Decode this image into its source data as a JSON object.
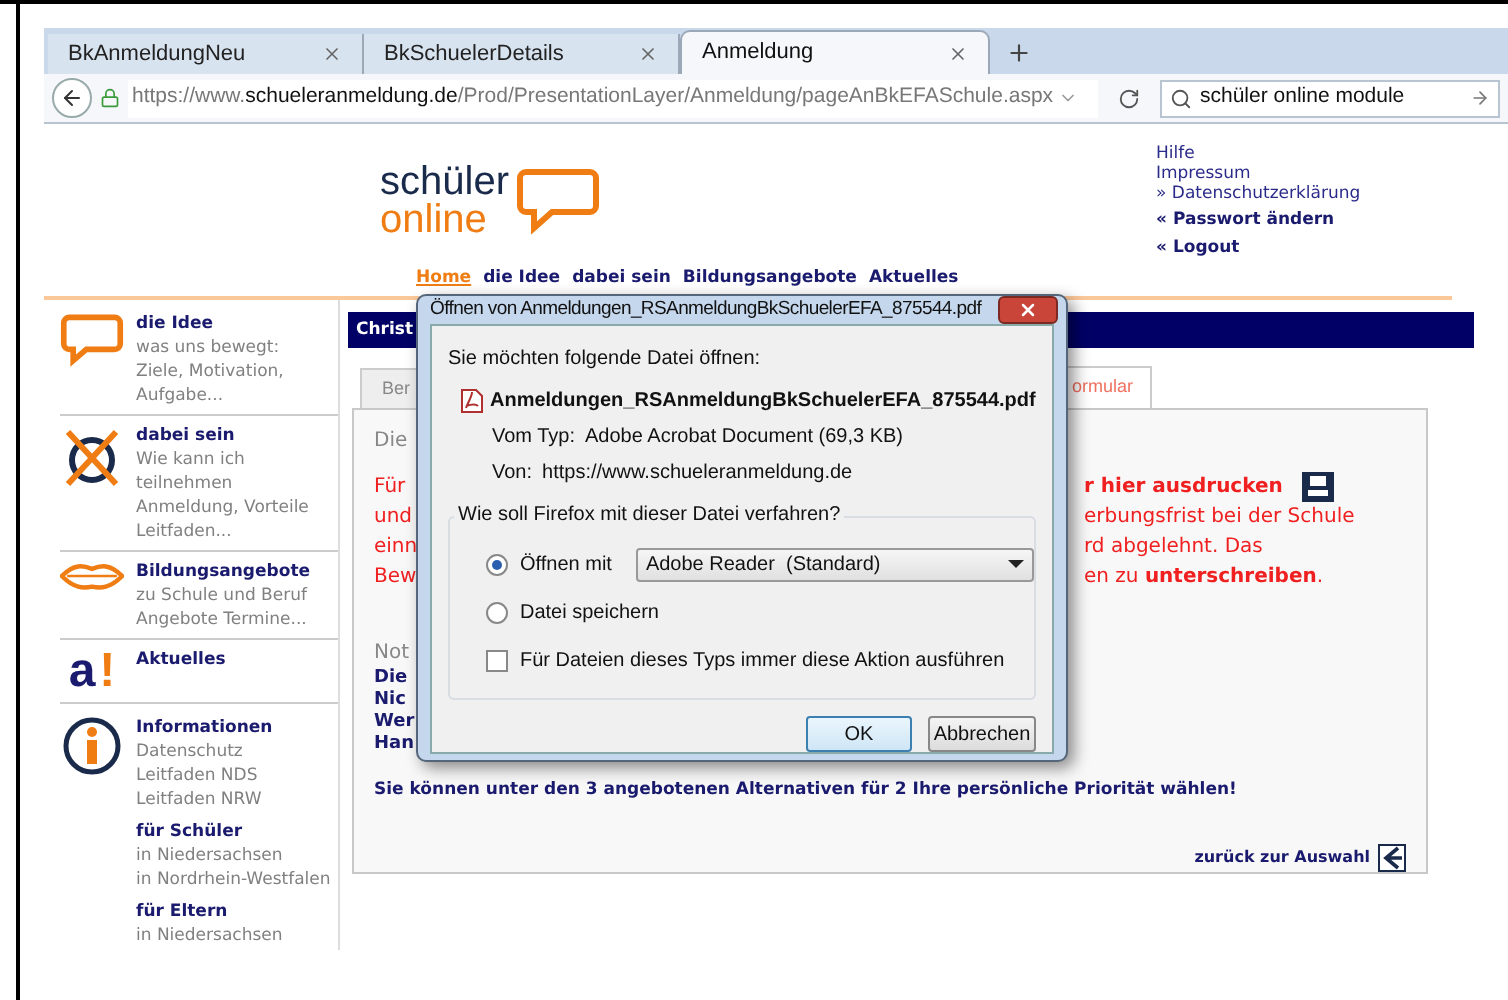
{
  "browser": {
    "tabs": [
      {
        "label": "BkAnmeldungNeu",
        "selected": false
      },
      {
        "label": "BkSchuelerDetails",
        "selected": false
      },
      {
        "label": "Anmeldung",
        "selected": true
      }
    ],
    "url": "https://www.**schueleranmeldung.de**/Prod/PresentationLayer/Anmeldung/pageAnBkEFASchule.aspx",
    "search": {
      "value": "schüler online module"
    }
  },
  "logo": {
    "line1": "schüler",
    "line2": "online"
  },
  "top_links": [
    {
      "text": "Hilfe",
      "kind": "plain"
    },
    {
      "text": "Impressum",
      "kind": "plain"
    },
    {
      "text": "» Datenschutzerklärung",
      "kind": "plain"
    },
    {
      "text": "« Passwort ändern",
      "kind": "bold"
    },
    {
      "text": "« Logout",
      "kind": "bold"
    }
  ],
  "nav": [
    {
      "label": "Home",
      "selected": true
    },
    {
      "label": "die Idee",
      "selected": false
    },
    {
      "label": "dabei sein",
      "selected": false
    },
    {
      "label": "Bildungsangebote",
      "selected": false
    },
    {
      "label": "Aktuelles",
      "selected": false
    }
  ],
  "sidebar": [
    {
      "kind": "bubble",
      "title": "die Idee",
      "lines": [
        "was uns bewegt:",
        "Ziele, Motivation,",
        "Aufgabe..."
      ]
    },
    {
      "kind": "cross",
      "title": "dabei sein",
      "lines": [
        "Wie kann ich",
        "teilnehmen",
        "Anmeldung, Vorteile",
        "Leitfaden..."
      ]
    },
    {
      "kind": "lips",
      "title": "Bildungsangebote",
      "lines": [
        "zu Schule und Beruf",
        "Angebote Termine..."
      ]
    },
    {
      "kind": "letter",
      "title": "Aktuelles",
      "logo_letter": "a",
      "logo_mark": "!"
    },
    {
      "kind": "info",
      "title": "Informationen",
      "lines": [
        "Datenschutz",
        "Leitfaden NDS",
        "Leitfaden NRW"
      ],
      "groups": [
        {
          "title": "für Schüler",
          "lines": [
            "in Niedersachsen",
            "in Nordrhein-Westfalen"
          ]
        },
        {
          "title": "für Eltern",
          "lines": [
            "in Niedersachsen"
          ]
        }
      ]
    }
  ],
  "main": {
    "banner": "Christ",
    "tabs": [
      {
        "label": "Ber",
        "selected": false
      },
      {
        "label": "ormular",
        "selected": true
      }
    ],
    "intro": "Die",
    "warning": [
      {
        "left": "Für",
        "right": "r hier ausdrucken",
        "bold": true,
        "kind": "print"
      },
      {
        "left": "und",
        "right": "erbungsfrist bei der Schule",
        "bold": false,
        "kind": "text"
      },
      {
        "left": "einn",
        "right": "rd abgelehnt. Das",
        "bold": false,
        "kind": "text"
      },
      {
        "left": "Bew",
        "right": "en zu **unterschreiben**.",
        "bold": false,
        "kind": "text"
      }
    ],
    "notes_label": "Not",
    "notes": [
      "Die",
      "Nic",
      "Wer",
      "Han"
    ],
    "priority": "Sie können unter den 3 angebotenen Alternativen für 2 Ihre persönliche Priorität wählen!",
    "back_link": "zurück zur Auswahl"
  },
  "dialog": {
    "title": "Öffnen von Anmeldungen_RSAnmeldungBkSchuelerEFA_875544.pdf",
    "prompt": "Sie möchten folgende Datei öffnen:",
    "filename": "Anmeldungen_RSAnmeldungBkSchuelerEFA_875544.pdf",
    "type_label": "Vom Typ:",
    "type_value": "Adobe Acrobat Document (69,3 KB)",
    "from_label": "Von:",
    "from_value": "https://www.schueleranmeldung.de",
    "group_label": "Wie soll Firefox mit dieser Datei verfahren?",
    "options": [
      {
        "label": "Öffnen mit",
        "selected": true
      },
      {
        "label": "Datei speichern",
        "selected": false
      }
    ],
    "app": "Adobe Reader  (Standard)",
    "remember": {
      "label": "Für Dateien dieses Typs immer diese Aktion ausführen",
      "checked": false
    },
    "buttons": [
      {
        "label": "OK",
        "kind": "default"
      },
      {
        "label": "Abbrechen",
        "kind": "normal"
      }
    ]
  }
}
